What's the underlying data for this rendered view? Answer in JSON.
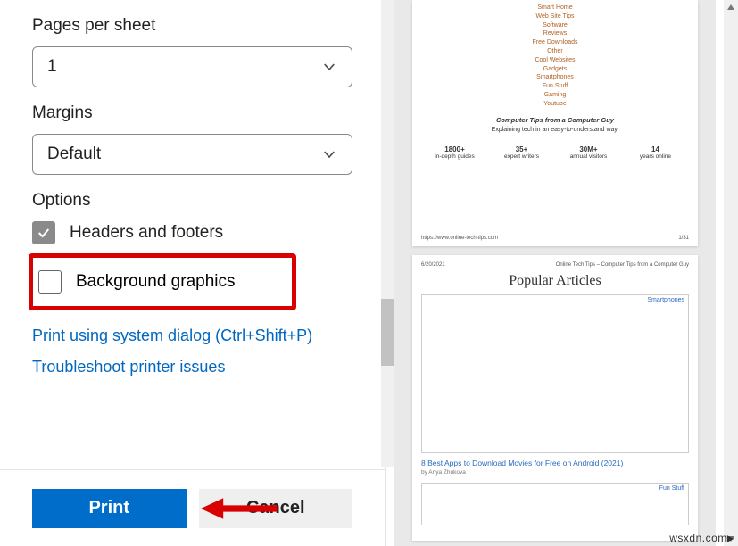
{
  "settings": {
    "pages_per_sheet": {
      "label": "Pages per sheet",
      "value": "1"
    },
    "margins": {
      "label": "Margins",
      "value": "Default"
    },
    "options": {
      "label": "Options",
      "headers_footers": {
        "label": "Headers and footers",
        "checked": true
      },
      "background_graphics": {
        "label": "Background graphics",
        "checked": false
      }
    },
    "links": {
      "system_dialog": "Print using system dialog (Ctrl+Shift+P)",
      "troubleshoot": "Troubleshoot printer issues"
    }
  },
  "buttons": {
    "print": "Print",
    "cancel": "Cancel"
  },
  "preview": {
    "page1": {
      "categories": [
        "Smart Home",
        "Web Site Tips",
        "Software",
        "Reviews",
        "Free Downloads",
        "Other",
        "Cool Websites",
        "Gadgets",
        "Smartphones",
        "Fun Stuff",
        "Gaming",
        "Youtube"
      ],
      "tagline": "Computer Tips from a Computer Guy",
      "subline": "Explaining tech in an easy-to-understand way.",
      "stats": [
        {
          "big": "1800+",
          "small1": "in-depth",
          "small2": "guides"
        },
        {
          "big": "35+",
          "small1": "expert",
          "small2": "writers"
        },
        {
          "big": "30M+",
          "small1": "annual",
          "small2": "visitors"
        },
        {
          "big": "14",
          "small1": "years",
          "small2": "online"
        }
      ],
      "footer_url": "https://www.online-tech-tips.com",
      "footer_page": "1/31"
    },
    "page2": {
      "header_date": "6/20/2021",
      "header_title": "Online Tech Tips – Computer Tips from a Computer Guy",
      "heading": "Popular Articles",
      "card1_tag": "Smartphones",
      "article_title": "8 Best Apps to Download Movies for Free on Android (2021)",
      "article_by": "by Anya Zhukova",
      "card2_tag": "Fun Stuff"
    }
  },
  "watermark": "wsxdn.com"
}
